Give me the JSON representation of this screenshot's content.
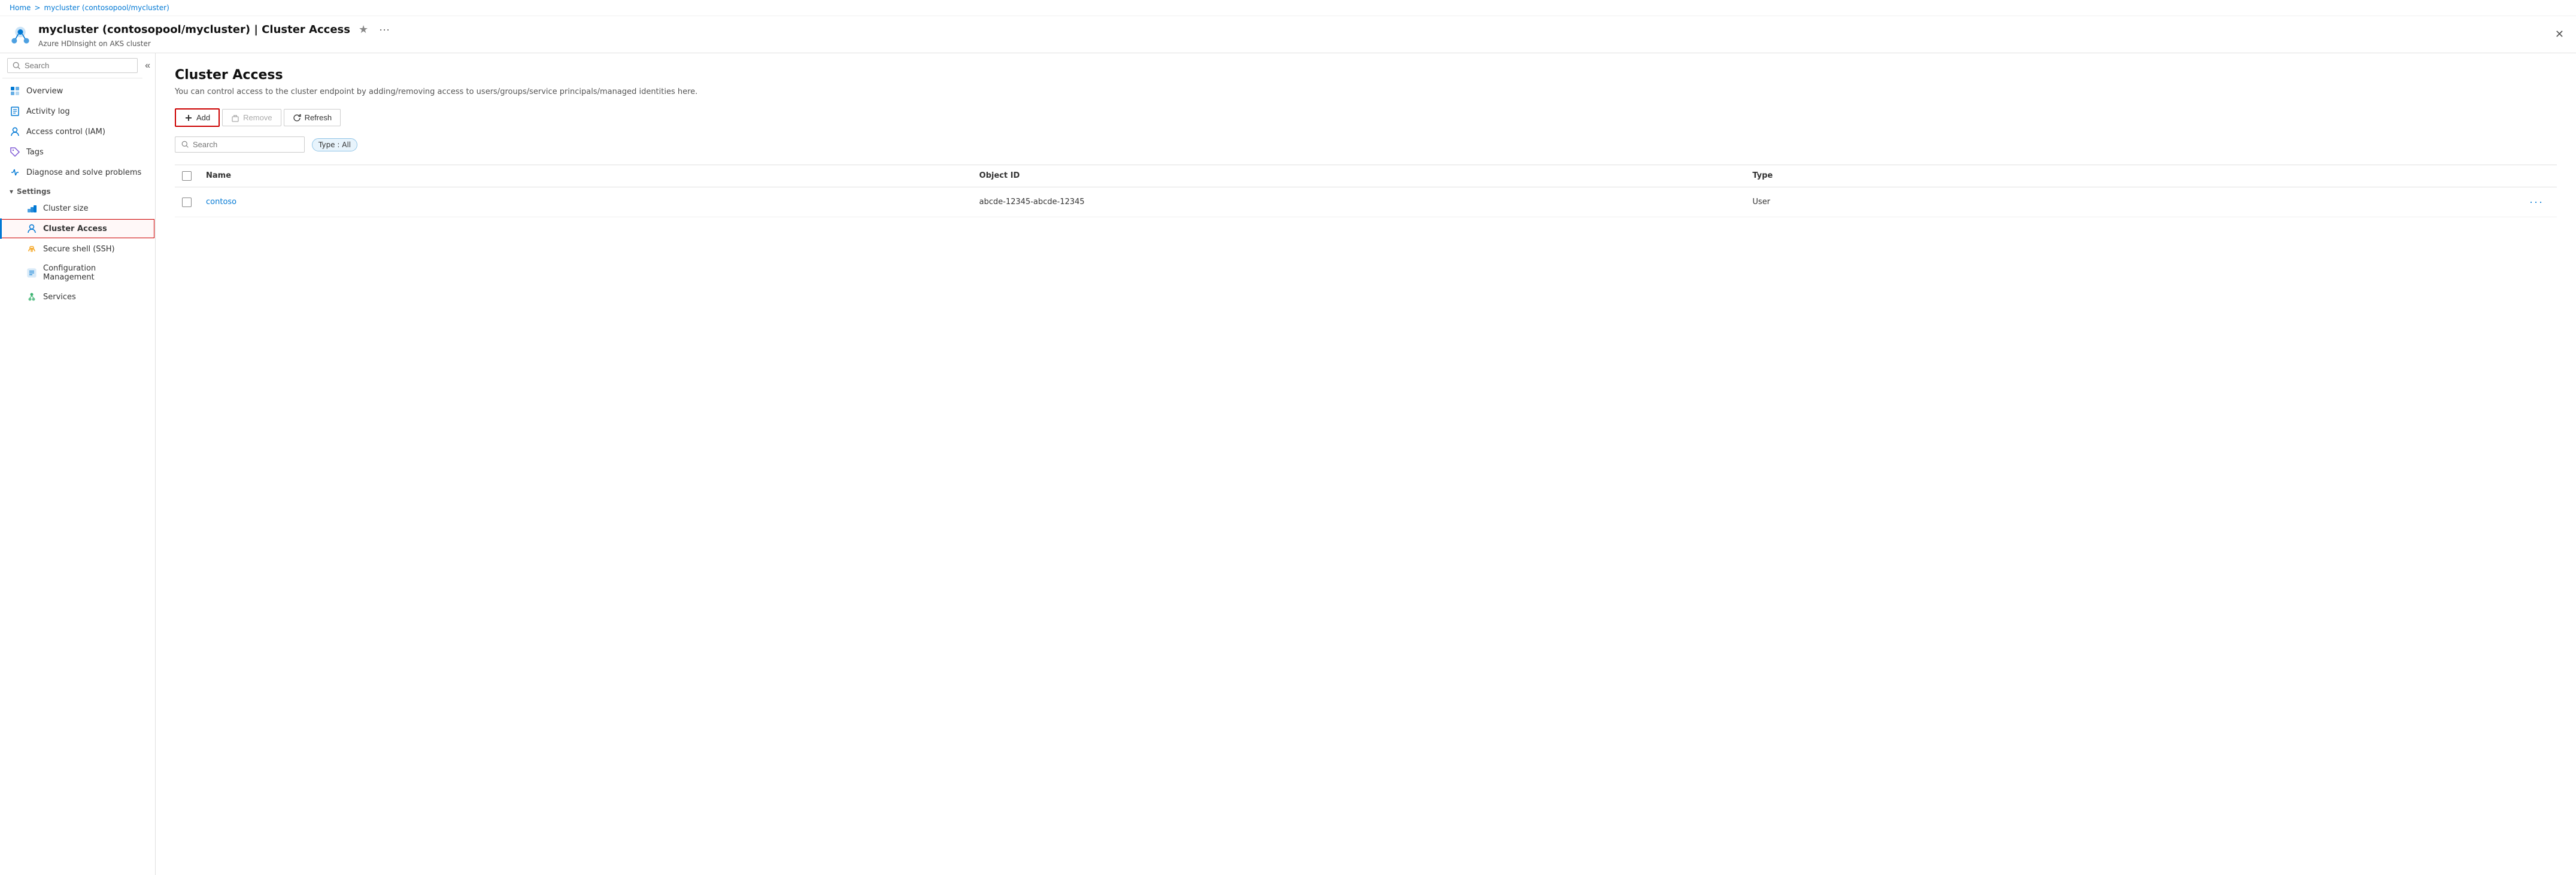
{
  "breadcrumb": {
    "home": "Home",
    "separator": ">",
    "cluster": "mycluster (contosopool/mycluster)"
  },
  "header": {
    "title": "mycluster (contosopool/mycluster) | Cluster Access",
    "subtitle": "Azure HDInsight on AKS cluster",
    "star_label": "★",
    "more_label": "···",
    "close_label": "✕"
  },
  "sidebar": {
    "search_placeholder": "Search",
    "collapse_label": "«",
    "nav_items": [
      {
        "id": "overview",
        "label": "Overview",
        "icon": "overview"
      },
      {
        "id": "activity-log",
        "label": "Activity log",
        "icon": "activity"
      },
      {
        "id": "access-control",
        "label": "Access control (IAM)",
        "icon": "iam"
      },
      {
        "id": "tags",
        "label": "Tags",
        "icon": "tags"
      },
      {
        "id": "diagnose",
        "label": "Diagnose and solve problems",
        "icon": "diagnose"
      }
    ],
    "settings_section": "Settings",
    "settings_items": [
      {
        "id": "cluster-size",
        "label": "Cluster size",
        "icon": "cluster-size"
      },
      {
        "id": "cluster-access",
        "label": "Cluster Access",
        "icon": "cluster-access",
        "active": true
      },
      {
        "id": "secure-shell",
        "label": "Secure shell (SSH)",
        "icon": "ssh"
      },
      {
        "id": "config-management",
        "label": "Configuration Management",
        "icon": "config"
      },
      {
        "id": "services",
        "label": "Services",
        "icon": "services"
      }
    ]
  },
  "content": {
    "title": "Cluster Access",
    "description": "You can control access to the cluster endpoint by adding/removing access to users/groups/service principals/managed identities here.",
    "toolbar": {
      "add_label": "Add",
      "remove_label": "Remove",
      "refresh_label": "Refresh"
    },
    "filter": {
      "search_placeholder": "Search",
      "type_filter_label": "Type : All"
    },
    "table": {
      "columns": [
        "",
        "Name",
        "Object ID",
        "Type",
        ""
      ],
      "rows": [
        {
          "name": "contoso",
          "object_id": "abcde-12345-abcde-12345",
          "type": "User"
        }
      ]
    }
  }
}
